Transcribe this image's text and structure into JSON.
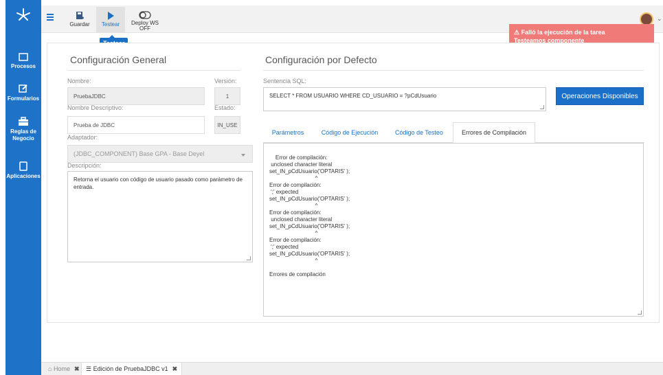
{
  "toolbar": {
    "guardar": "Guardar",
    "testear": "Testear",
    "deploy": "Deploy WS",
    "deploy_state": "OFF",
    "tooltip": "Testear"
  },
  "sidebar": {
    "items": [
      {
        "label": "Procesos",
        "icon": "window-icon"
      },
      {
        "label": "Formularios",
        "icon": "edit-icon"
      },
      {
        "label": "Reglas de Negocio",
        "icon": "briefcase-icon"
      },
      {
        "label": "Aplicaciones",
        "icon": "tablet-icon"
      }
    ]
  },
  "alert": {
    "title": "Falló la ejecución de la tarea",
    "message": "Testeamos componente",
    "color": "#f07a78"
  },
  "general": {
    "title": "Configuración General",
    "nombre_label": "Nombre:",
    "nombre": "PruebaJDBC",
    "version_label": "Versión:",
    "version": "1",
    "desc_name_label": "Nombre Descriptivo:",
    "desc_name": "Prueba de JDBC",
    "estado_label": "Estado:",
    "estado": "IN_USE",
    "adaptador_label": "Adaptador:",
    "adaptador": "(JDBC_COMPONENT) Base GPA - Base Deyel",
    "descripcion_label": "Descripción:",
    "descripcion": "Retorna el usuario con código de usuario pasado como parámetro de entrada."
  },
  "defaults": {
    "title": "Configuración por Defecto",
    "sql_label": "Sentencia SQL:",
    "sql": "SELECT * FROM USUARIO WHERE CD_USUARIO = ?pCdUsuario",
    "ops_button": "Operaciones Disponibles",
    "tabs": [
      "Parámetros",
      "Código de Ejecución",
      "Código de Testeo",
      "Errores de Compilación"
    ],
    "active_tab": "Errores de Compilación",
    "errors": "Error de compilación:\n unclosed character literal\nset_IN_pCdUsuario('OPTARIS' );\n                              ^\nError de compilación:\n ';' expected\nset_IN_pCdUsuario('OPTARIS' );\n                              ^\nError de compilación:\n unclosed character literal\nset_IN_pCdUsuario('OPTARIS' );\n                              ^\nError de compilación:\n ';' expected\nset_IN_pCdUsuario('OPTARIS' );\n                              ^\n\nErrores de compilación"
  },
  "bottom_tabs": [
    {
      "label": "Home",
      "icon": "home-icon"
    },
    {
      "label": "Edición de PruebaJDBC v1",
      "icon": "list-icon"
    }
  ],
  "colors": {
    "brand": "#1a6fc6"
  }
}
